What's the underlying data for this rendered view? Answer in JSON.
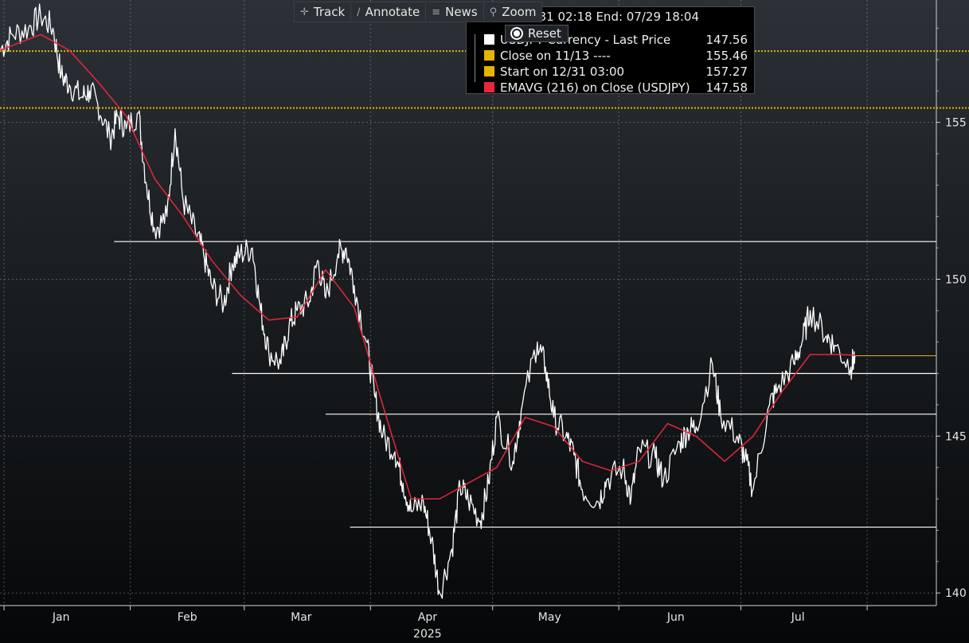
{
  "toolbar": {
    "track_label": "Track",
    "annotate_label": "Annotate",
    "news_label": "News",
    "zoom_label": "Zoom"
  },
  "legend": {
    "range_text": "Start: 12/31 02:18 End: 07/29 18:04",
    "reset_label": "Reset",
    "rows": [
      {
        "label": "USDJPY Currency - Last Price",
        "value": "147.56",
        "color": "#ffffff"
      },
      {
        "label": "Close on 11/13 ----",
        "value": "155.46",
        "color": "#e6b400"
      },
      {
        "label": "Start on 12/31 03:00",
        "value": "157.27",
        "color": "#e6b400"
      },
      {
        "label": "EMAVG (216)  on Close (USDJPY)",
        "value": "147.58",
        "color": "#e8263c"
      }
    ]
  },
  "colors": {
    "price": "#ffffff",
    "ema": "#e8263c",
    "reference_line": "#e6b400",
    "horizontal_level": "#ffffff",
    "grid": "#8c9196"
  },
  "chart_data": {
    "type": "line",
    "x_unit": "date (2025)",
    "y_unit": "JPY per USD",
    "ylim": [
      139.6,
      158.9
    ],
    "yticks": [
      140,
      145,
      150,
      155
    ],
    "x_month_labels": [
      "Jan",
      "Feb",
      "Mar",
      "Apr",
      "May",
      "Jun",
      "Jul"
    ],
    "x_year_label": "2025",
    "grid": "dotted",
    "series": [
      {
        "name": "USDJPY Currency - Last Price",
        "x": [
          "2024-12-31",
          "2025-01-03",
          "2025-01-07",
          "2025-01-10",
          "2025-01-13",
          "2025-01-15",
          "2025-01-17",
          "2025-01-20",
          "2025-01-22",
          "2025-01-24",
          "2025-01-27",
          "2025-01-29",
          "2025-01-31",
          "2025-02-03",
          "2025-02-05",
          "2025-02-07",
          "2025-02-10",
          "2025-02-12",
          "2025-02-14",
          "2025-02-17",
          "2025-02-19",
          "2025-02-21",
          "2025-02-24",
          "2025-02-26",
          "2025-02-28",
          "2025-03-03",
          "2025-03-05",
          "2025-03-07",
          "2025-03-10",
          "2025-03-12",
          "2025-03-14",
          "2025-03-17",
          "2025-03-19",
          "2025-03-21",
          "2025-03-24",
          "2025-03-26",
          "2025-03-28",
          "2025-03-31",
          "2025-04-02",
          "2025-04-04",
          "2025-04-07",
          "2025-04-09",
          "2025-04-11",
          "2025-04-14",
          "2025-04-16",
          "2025-04-18",
          "2025-04-21",
          "2025-04-23",
          "2025-04-25",
          "2025-04-28",
          "2025-04-30",
          "2025-05-02",
          "2025-05-06",
          "2025-05-08",
          "2025-05-12",
          "2025-05-14",
          "2025-05-16",
          "2025-05-19",
          "2025-05-21",
          "2025-05-23",
          "2025-05-27",
          "2025-05-29",
          "2025-06-02",
          "2025-06-04",
          "2025-06-06",
          "2025-06-10",
          "2025-06-12",
          "2025-06-16",
          "2025-06-18",
          "2025-06-20",
          "2025-06-24",
          "2025-06-26",
          "2025-06-30",
          "2025-07-02",
          "2025-07-04",
          "2025-07-08",
          "2025-07-10",
          "2025-07-14",
          "2025-07-16",
          "2025-07-18",
          "2025-07-22",
          "2025-07-24",
          "2025-07-28",
          "2025-07-29"
        ],
        "values": [
          157.3,
          157.8,
          158.0,
          158.4,
          158.0,
          156.5,
          156.2,
          155.8,
          156.0,
          155.6,
          154.5,
          155.2,
          154.8,
          155.3,
          153.0,
          151.6,
          152.0,
          154.8,
          152.5,
          151.5,
          150.8,
          149.8,
          149.2,
          150.5,
          150.8,
          151.0,
          149.0,
          147.7,
          147.3,
          148.5,
          149.0,
          149.3,
          150.6,
          149.4,
          150.8,
          151.0,
          149.8,
          148.0,
          146.3,
          145.0,
          144.5,
          143.5,
          142.6,
          142.9,
          141.7,
          140.0,
          141.4,
          143.4,
          143.0,
          142.3,
          143.5,
          145.6,
          144.2,
          145.8,
          148.0,
          147.2,
          145.6,
          145.0,
          144.4,
          143.3,
          142.9,
          143.6,
          144.0,
          143.0,
          144.6,
          144.3,
          143.6,
          144.8,
          145.2,
          145.3,
          147.3,
          145.7,
          145.0,
          144.3,
          143.3,
          146.0,
          146.5,
          147.3,
          148.0,
          149.0,
          148.2,
          147.9,
          147.2,
          147.56
        ]
      },
      {
        "name": "EMAVG (216)  on Close (USDJPY)",
        "x": [
          "2024-12-31",
          "2025-01-10",
          "2025-01-17",
          "2025-01-24",
          "2025-01-31",
          "2025-02-07",
          "2025-02-14",
          "2025-02-21",
          "2025-02-28",
          "2025-03-07",
          "2025-03-14",
          "2025-03-21",
          "2025-03-28",
          "2025-04-04",
          "2025-04-11",
          "2025-04-18",
          "2025-04-25",
          "2025-05-02",
          "2025-05-09",
          "2025-05-16",
          "2025-05-23",
          "2025-05-30",
          "2025-06-06",
          "2025-06-13",
          "2025-06-20",
          "2025-06-27",
          "2025-07-04",
          "2025-07-11",
          "2025-07-18",
          "2025-07-25",
          "2025-07-29"
        ],
        "values": [
          157.3,
          157.8,
          157.3,
          156.3,
          155.2,
          153.2,
          152.0,
          150.6,
          149.5,
          148.7,
          148.8,
          150.3,
          149.1,
          146.0,
          143.0,
          143.0,
          143.5,
          144.0,
          145.6,
          145.3,
          144.2,
          143.9,
          144.2,
          145.4,
          145.0,
          144.2,
          145.0,
          146.4,
          147.6,
          147.6,
          147.58
        ]
      }
    ],
    "reference_lines": [
      {
        "name": "Close on 11/13",
        "y": 155.46
      },
      {
        "name": "Start on 12/31 03:00",
        "y": 157.27
      }
    ],
    "horizontal_levels": [
      151.2,
      147.0,
      145.7,
      142.1
    ]
  }
}
